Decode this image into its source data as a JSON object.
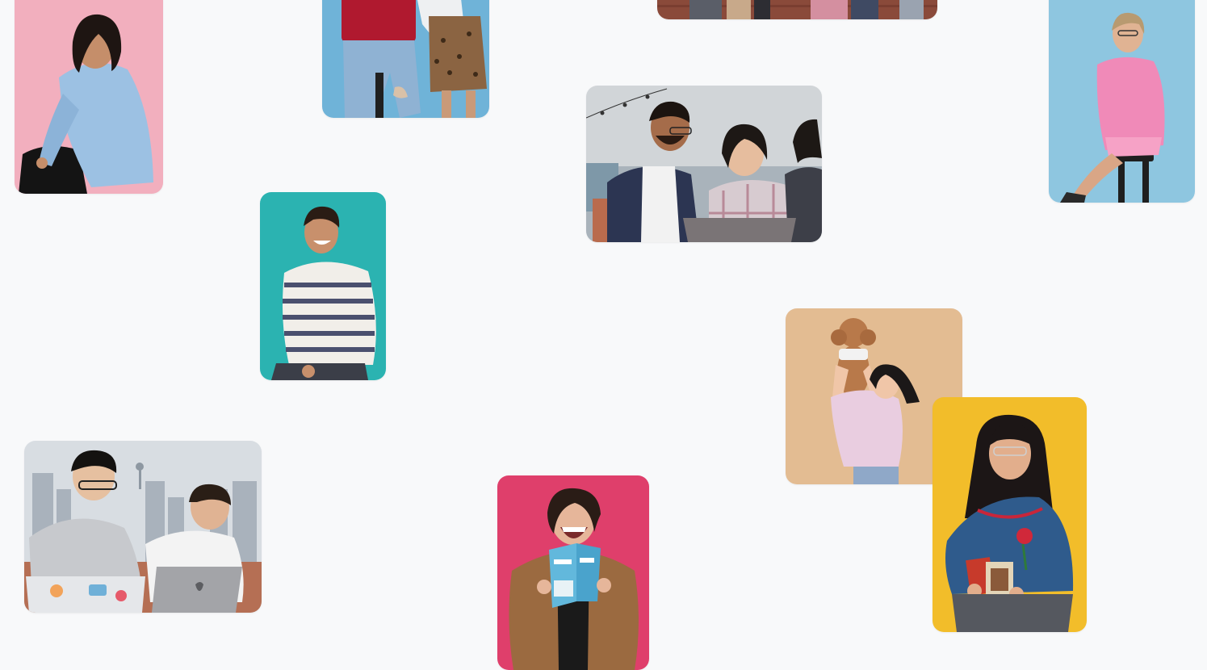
{
  "photos": [
    {
      "id": "pink-bg-woman-denim-shirt",
      "bg": "#f1a9b8"
    },
    {
      "id": "blue-bg-two-people-jeans",
      "bg": "#6fb3d8"
    },
    {
      "id": "brick-wall-group",
      "bg": "#8a4a3a"
    },
    {
      "id": "blue-bg-woman-pink-sweater",
      "bg": "#8ec6e0"
    },
    {
      "id": "rooftop-friends-laptop",
      "bg": "#c8ccd0"
    },
    {
      "id": "teal-bg-man-striped-shirt",
      "bg": "#2bb3b1"
    },
    {
      "id": "tan-bg-woman-with-dog",
      "bg": "#e3bc92"
    },
    {
      "id": "yellow-bg-woman-holding-books",
      "bg": "#f2bd2a"
    },
    {
      "id": "city-skyline-two-men-laptops",
      "bg": "#c9cfd6"
    },
    {
      "id": "magenta-bg-woman-reading-book",
      "bg": "#df3f6b"
    }
  ]
}
